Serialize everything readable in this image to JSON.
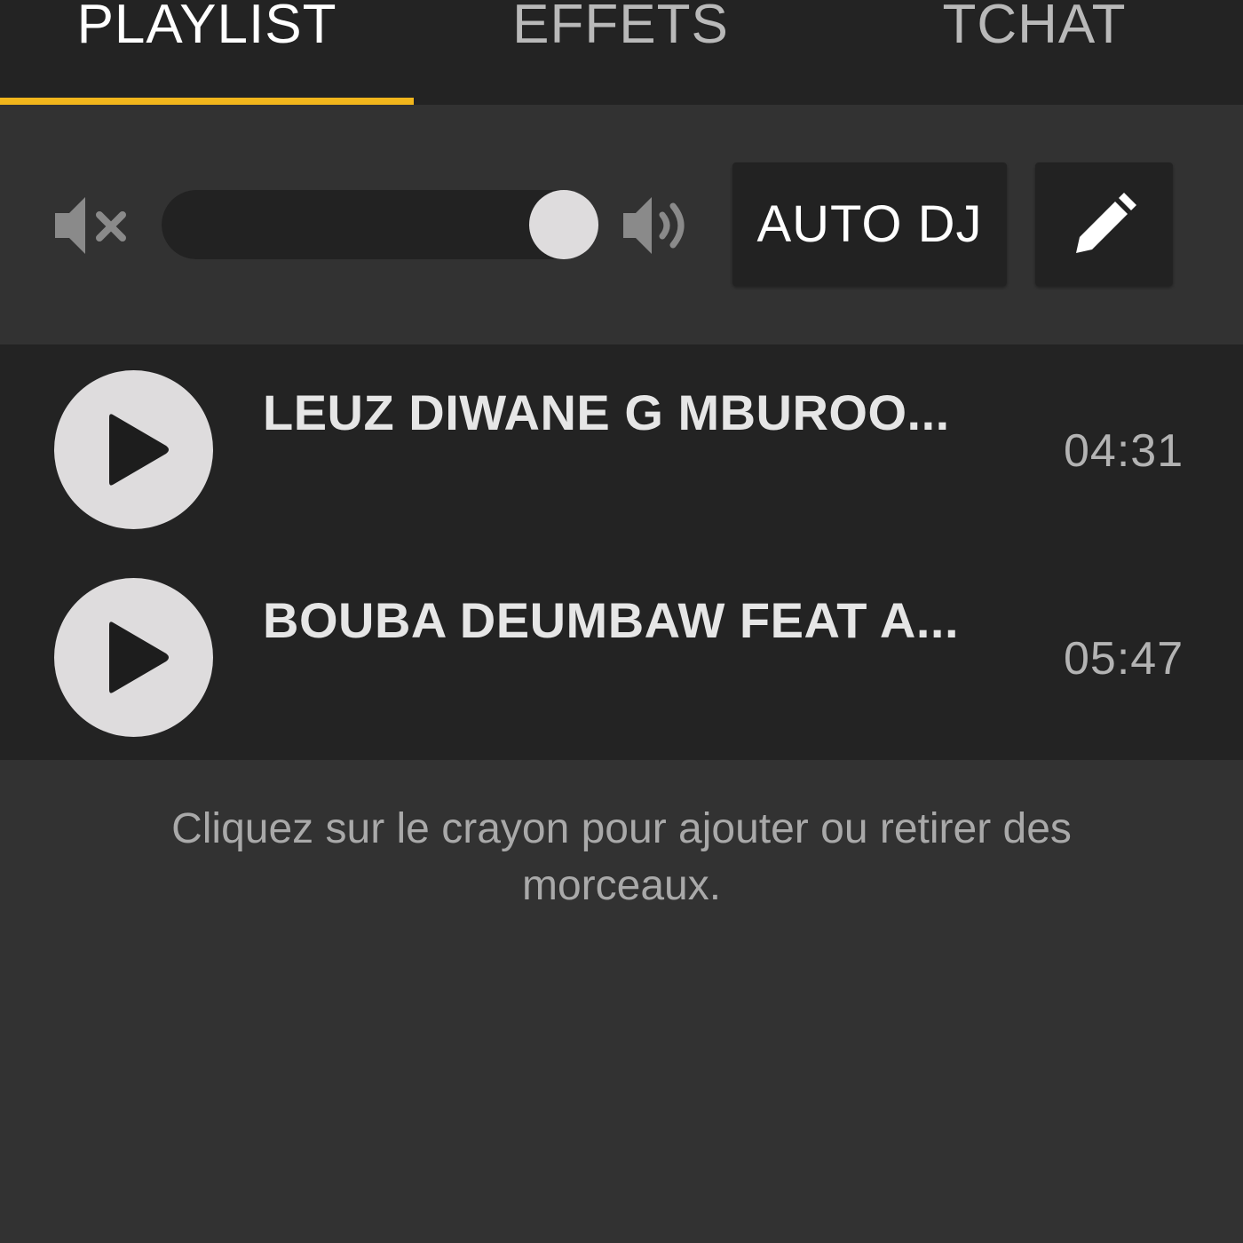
{
  "tabs": [
    {
      "label": "PLAYLIST",
      "active": true
    },
    {
      "label": "EFFETS",
      "active": false
    },
    {
      "label": "TCHAT",
      "active": false
    }
  ],
  "accent_color": "#f2b61c",
  "controls": {
    "mute_icon": "volume-mute-icon",
    "volume_icon": "volume-up-icon",
    "volume_level": 0.92,
    "auto_dj_label": "AUTO DJ",
    "edit_icon": "pencil-icon"
  },
  "playlist": {
    "tracks": [
      {
        "title": "LEUZ DIWANE G MBUROO...",
        "duration": "04:31",
        "icon": "play-icon"
      },
      {
        "title": "BOUBA DEUMBAW FEAT A...",
        "duration": "05:47",
        "icon": "play-icon"
      }
    ]
  },
  "help_text": "Cliquez sur le crayon pour ajouter ou retirer des morceaux."
}
